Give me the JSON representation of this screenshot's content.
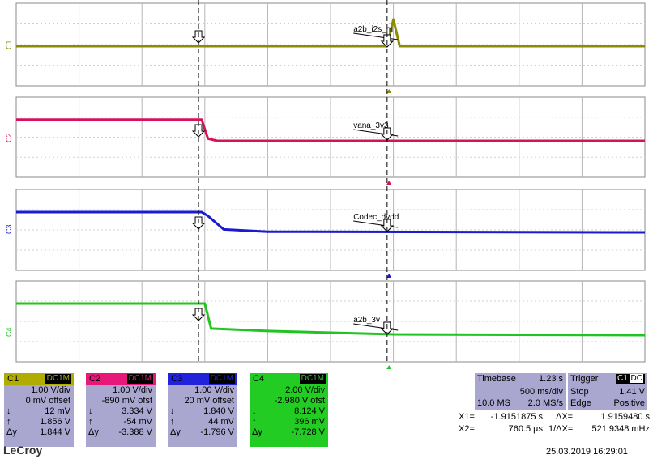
{
  "channels": [
    {
      "id": "C1",
      "coupling": "DC1M",
      "color": "#8c8c00",
      "scale": "1.00 V/div",
      "offset": "0 mV offset",
      "down": "12 mV",
      "up": "1.856 V",
      "dy_label": "Δy",
      "dy": "1.844 V",
      "label": "a2b_i2s_m"
    },
    {
      "id": "C2",
      "coupling": "DC1M",
      "color": "#d4145a",
      "scale": "1.00 V/div",
      "offset": "-890 mV ofst",
      "down": "3.334 V",
      "up": "-54 mV",
      "dy_label": "Δy",
      "dy": "-3.388 V",
      "label": "vana_3v3"
    },
    {
      "id": "C3",
      "coupling": "DC1M",
      "color": "#1a1ad0",
      "scale": "1.00 V/div",
      "offset": "20 mV offset",
      "down": "1.840 V",
      "up": "44 mV",
      "dy_label": "Δy",
      "dy": "-1.796 V",
      "label": "Codec_dvdd"
    },
    {
      "id": "C4",
      "coupling": "DC1M",
      "color": "#22c422",
      "scale": "2.00 V/div",
      "offset": "-2.980 V ofst",
      "down": "8.124 V",
      "up": "396 mV",
      "dy_label": "Δy",
      "dy": "-7.728 V",
      "label": "a2b_3v"
    }
  ],
  "timebase": {
    "title": "Timebase",
    "value": "1.23 s",
    "per_div": "500 ms/div",
    "samples": "10.0 MS",
    "rate": "2.0 MS/s"
  },
  "trigger": {
    "title": "Trigger",
    "ch": "C1",
    "cpl": "DC",
    "mode": "Stop",
    "level": "1.41 V",
    "type": "Edge",
    "slope": "Positive"
  },
  "cursors": {
    "x1_label": "X1=",
    "x1": "-1.9151875 s",
    "dx_label": "ΔX=",
    "dx": "1.9159480 s",
    "x2_label": "X2=",
    "x2": "760.5 µs",
    "inv_label": "1/ΔX=",
    "inv": "521.9348 mHz"
  },
  "brand": "LeCroy",
  "timestamp": "25.03.2019 16:29:01",
  "symbols": {
    "down": "↓",
    "up": "↑"
  },
  "chart_data": {
    "type": "line",
    "title": "",
    "x_range_div": [
      0,
      10
    ],
    "cursor_x_div": [
      2.9,
      5.9
    ],
    "series": [
      {
        "name": "C1",
        "points": [
          [
            0,
            0.1
          ],
          [
            5.9,
            0.1
          ],
          [
            6.0,
            1.7
          ],
          [
            6.1,
            0.1
          ],
          [
            10,
            0.1
          ]
        ]
      },
      {
        "name": "C2",
        "points": [
          [
            0,
            3.33
          ],
          [
            2.95,
            3.33
          ],
          [
            3.05,
            0.3
          ],
          [
            3.2,
            -0.05
          ],
          [
            10,
            -0.05
          ]
        ]
      },
      {
        "name": "C3",
        "points": [
          [
            0,
            1.84
          ],
          [
            2.95,
            1.84
          ],
          [
            3.05,
            1.5
          ],
          [
            3.3,
            0.3
          ],
          [
            4,
            0.1
          ],
          [
            10,
            0.04
          ]
        ]
      },
      {
        "name": "C4",
        "points": [
          [
            0,
            8.12
          ],
          [
            3.0,
            8.12
          ],
          [
            3.1,
            2.0
          ],
          [
            4,
            1.4
          ],
          [
            6,
            0.6
          ],
          [
            10,
            0.4
          ]
        ]
      }
    ]
  }
}
